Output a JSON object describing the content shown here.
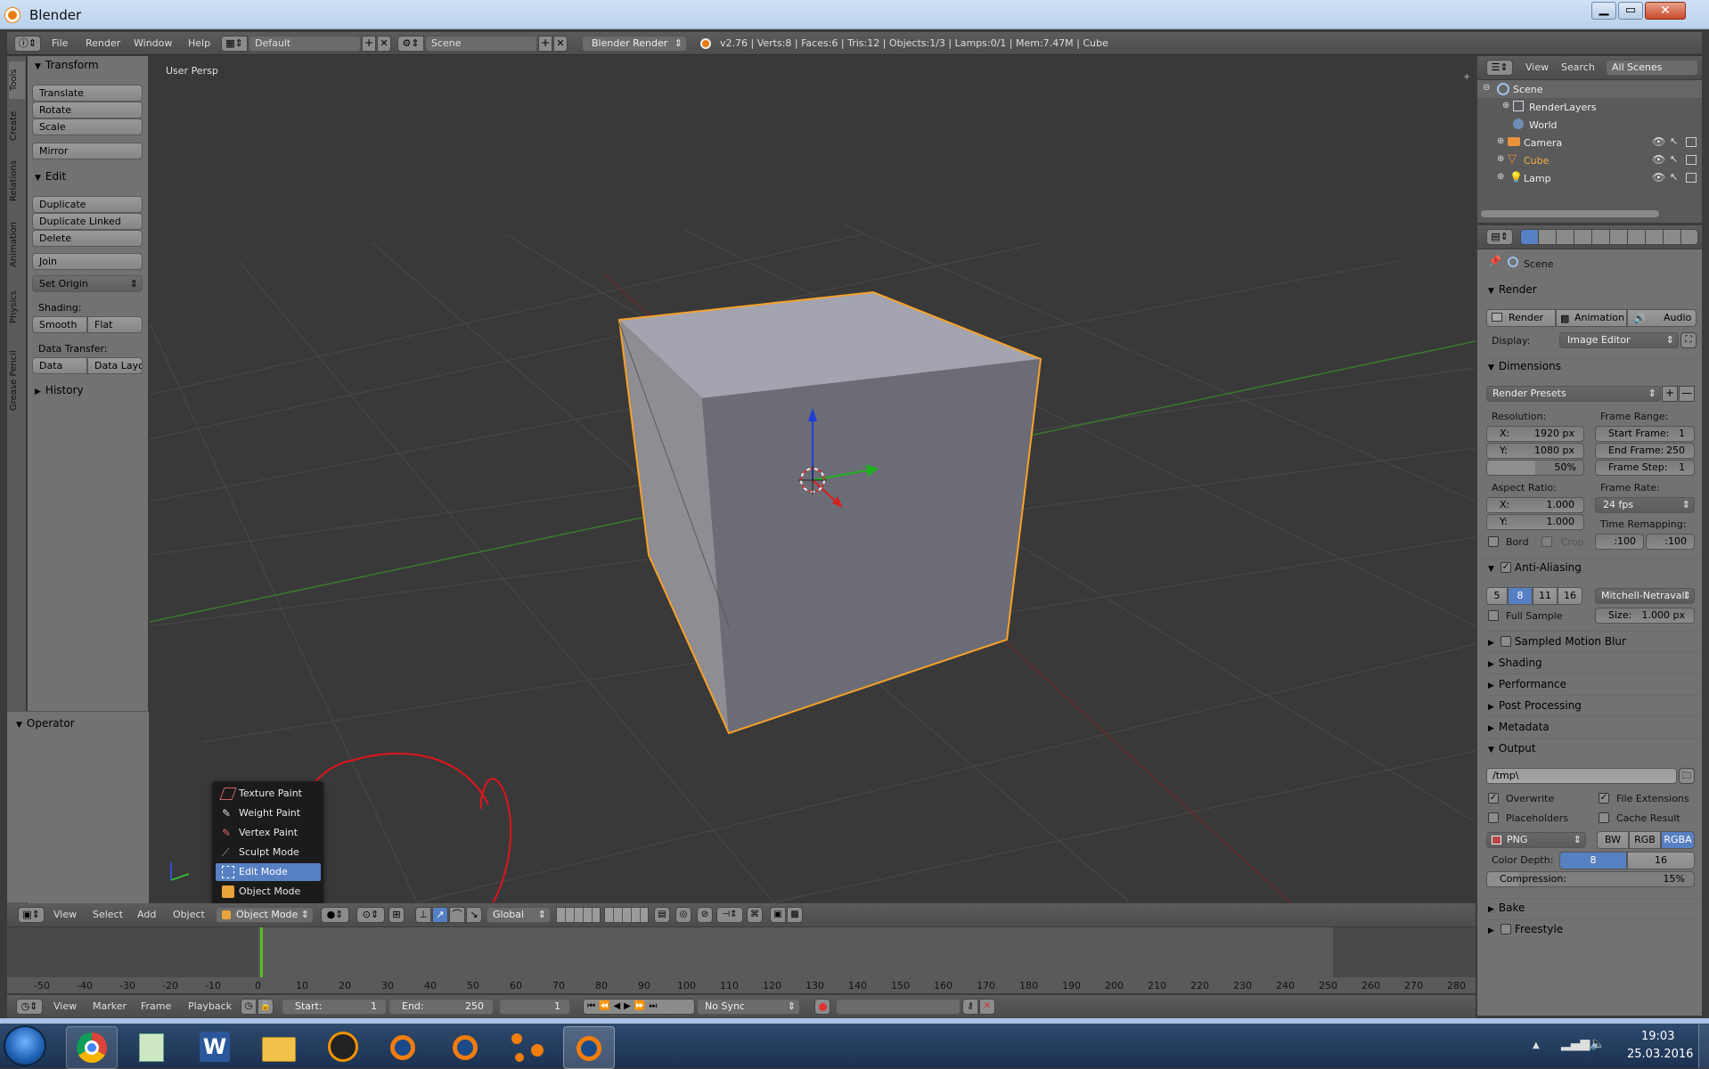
{
  "window": {
    "title": "Blender"
  },
  "info_bar": {
    "menus": [
      "File",
      "Render",
      "Window",
      "Help"
    ],
    "layout": "Default",
    "scene": "Scene",
    "engine": "Blender Render",
    "stats": "v2.76 | Verts:8 | Faces:6 | Tris:12 | Objects:1/3 | Lamps:0/1 | Mem:7.47M | Cube"
  },
  "tool_tabs": [
    "Tools",
    "Create",
    "Relations",
    "Animation",
    "Physics",
    "Grease Pencil"
  ],
  "tools": {
    "transform_header": "Transform",
    "translate": "Translate",
    "rotate": "Rotate",
    "scale": "Scale",
    "mirror": "Mirror",
    "edit_header": "Edit",
    "duplicate": "Duplicate",
    "duplicate_linked": "Duplicate Linked",
    "delete": "Delete",
    "join": "Join",
    "set_origin": "Set Origin",
    "shading_label": "Shading:",
    "smooth": "Smooth",
    "flat": "Flat",
    "data_transfer_label": "Data Transfer:",
    "data": "Data",
    "data_layout": "Data Layo",
    "history_header": "History",
    "operator_header": "Operator"
  },
  "viewport": {
    "label": "User Persp"
  },
  "mode_menu": {
    "items": [
      "Texture Paint",
      "Weight Paint",
      "Vertex Paint",
      "Sculpt Mode",
      "Edit Mode",
      "Object Mode"
    ],
    "highlighted": "Edit Mode"
  },
  "view3d_header": {
    "menus": [
      "View",
      "Select",
      "Add",
      "Object"
    ],
    "mode": "Object Mode",
    "orientation": "Global"
  },
  "timeline": {
    "ticks": [
      "-50",
      "-40",
      "-30",
      "-20",
      "-10",
      "0",
      "10",
      "20",
      "30",
      "40",
      "50",
      "60",
      "70",
      "80",
      "90",
      "100",
      "110",
      "120",
      "130",
      "140",
      "150",
      "160",
      "170",
      "180",
      "190",
      "200",
      "210",
      "220",
      "230",
      "240",
      "250",
      "260",
      "270",
      "280"
    ],
    "menus": [
      "View",
      "Marker",
      "Frame",
      "Playback"
    ],
    "start": "Start:",
    "start_val": "1",
    "end": "End:",
    "end_val": "250",
    "current": "1",
    "sync": "No Sync"
  },
  "outliner": {
    "menus": [
      "View",
      "Search"
    ],
    "filter": "All Scenes",
    "items": [
      "Scene",
      "RenderLayers",
      "World",
      "Camera",
      "Cube",
      "Lamp"
    ]
  },
  "properties": {
    "context": "Scene",
    "render_header": "Render",
    "render_btn": "Render",
    "animation_btn": "Animation",
    "audio_btn": "Audio",
    "display_label": "Display:",
    "display_value": "Image Editor",
    "dimensions_header": "Dimensions",
    "render_presets": "Render Presets",
    "resolution_label": "Resolution:",
    "res_x": "X:",
    "res_x_val": "1920 px",
    "res_y": "Y:",
    "res_y_val": "1080 px",
    "res_pct": "50%",
    "frame_range_label": "Frame Range:",
    "start_frame": "Start Frame:",
    "start_frame_val": "1",
    "end_frame": "End Frame:",
    "end_frame_val": "250",
    "frame_step": "Frame Step:",
    "frame_step_val": "1",
    "aspect_label": "Aspect Ratio:",
    "asp_x": "X:",
    "asp_x_val": "1.000",
    "asp_y": "Y:",
    "asp_y_val": "1.000",
    "frame_rate_label": "Frame Rate:",
    "frame_rate": "24 fps",
    "time_remap_label": "Time Remapping:",
    "remap_old": ":100",
    "remap_new": ":100",
    "bord": "Bord",
    "crop": "Crop",
    "aa_header": "Anti-Aliasing",
    "aa_samples": [
      "5",
      "8",
      "11",
      "16"
    ],
    "aa_filter": "Mitchell-Netravali",
    "full_sample": "Full Sample",
    "size_label": "Size:",
    "size_val": "1.000 px",
    "sampled_motion_blur": "Sampled Motion Blur",
    "shading": "Shading",
    "performance": "Performance",
    "post_processing": "Post Processing",
    "metadata": "Metadata",
    "output_header": "Output",
    "output_path": "/tmp\\",
    "overwrite": "Overwrite",
    "file_extensions": "File Extensions",
    "placeholders": "Placeholders",
    "cache_result": "Cache Result",
    "format": "PNG",
    "bw": "BW",
    "rgb": "RGB",
    "rgba": "RGBA",
    "color_depth_label": "Color Depth:",
    "depth_8": "8",
    "depth_16": "16",
    "compression_label": "Compression:",
    "compression_val": "15%",
    "bake": "Bake",
    "freestyle": "Freestyle"
  },
  "taskbar": {
    "time": "19:03",
    "date": "25.03.2016"
  },
  "colors": {
    "selection_outline": "#f7a12a",
    "menu_highlight": "#5680c2",
    "annotation_red": "#e0141e"
  }
}
